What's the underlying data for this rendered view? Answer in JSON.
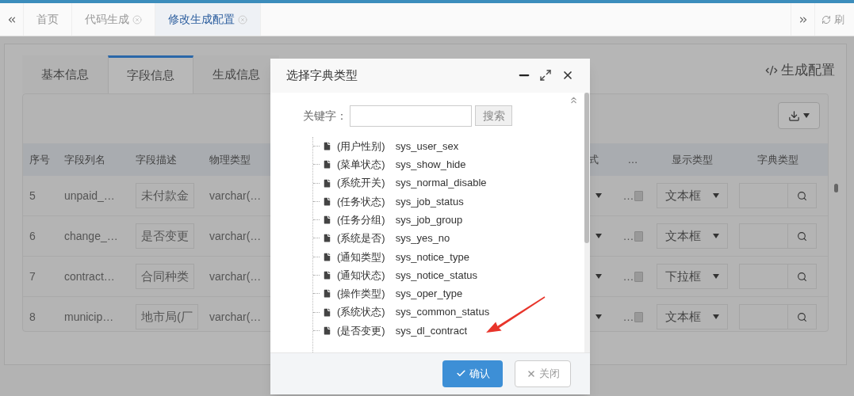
{
  "nav_tabs": [
    {
      "label": "首页",
      "closable": false,
      "selected": false
    },
    {
      "label": "代码生成",
      "closable": true,
      "selected": false
    },
    {
      "label": "修改生成配置",
      "closable": true,
      "selected": true
    }
  ],
  "refresh_label": "刷",
  "page": {
    "tabs": [
      {
        "label": "基本信息",
        "selected": false
      },
      {
        "label": "字段信息",
        "selected": true
      },
      {
        "label": "生成信息",
        "selected": false
      }
    ],
    "config_link": "生成配置",
    "left_columns": [
      "序号",
      "字段列名",
      "字段描述",
      "物理类型"
    ],
    "right_columns": [
      "式",
      "…",
      "显示类型",
      "字典类型"
    ],
    "rows": [
      {
        "index": "5",
        "column_name": "unpaid_…",
        "description": "未付款金",
        "type": "varchar(…",
        "ellipsis": "…",
        "checked": false,
        "display_type": "文本框"
      },
      {
        "index": "6",
        "column_name": "change_…",
        "description": "是否变更",
        "type": "varchar(…",
        "ellipsis": "…",
        "checked": false,
        "display_type": "文本框"
      },
      {
        "index": "7",
        "column_name": "contract…",
        "description": "合同种类",
        "type": "varchar(…",
        "ellipsis": "…",
        "checked": false,
        "display_type": "下拉框"
      },
      {
        "index": "8",
        "column_name": "municip…",
        "description": "地市局(厂",
        "type": "varchar(…",
        "ellipsis": "…",
        "checked": false,
        "display_type": "文本框"
      }
    ]
  },
  "dialog": {
    "title": "选择字典类型",
    "keyword_label": "关键字：",
    "search_button": "搜索",
    "items": [
      {
        "label": "(用户性别)",
        "type": "sys_user_sex"
      },
      {
        "label": "(菜单状态)",
        "type": "sys_show_hide"
      },
      {
        "label": "(系统开关)",
        "type": "sys_normal_disable"
      },
      {
        "label": "(任务状态)",
        "type": "sys_job_status"
      },
      {
        "label": "(任务分组)",
        "type": "sys_job_group"
      },
      {
        "label": "(系统是否)",
        "type": "sys_yes_no"
      },
      {
        "label": "(通知类型)",
        "type": "sys_notice_type"
      },
      {
        "label": "(通知状态)",
        "type": "sys_notice_status"
      },
      {
        "label": "(操作类型)",
        "type": "sys_oper_type"
      },
      {
        "label": "(系统状态)",
        "type": "sys_common_status"
      },
      {
        "label": "(是否变更)",
        "type": "sys_dl_contract"
      }
    ],
    "confirm": "确认",
    "close": "关闭"
  }
}
